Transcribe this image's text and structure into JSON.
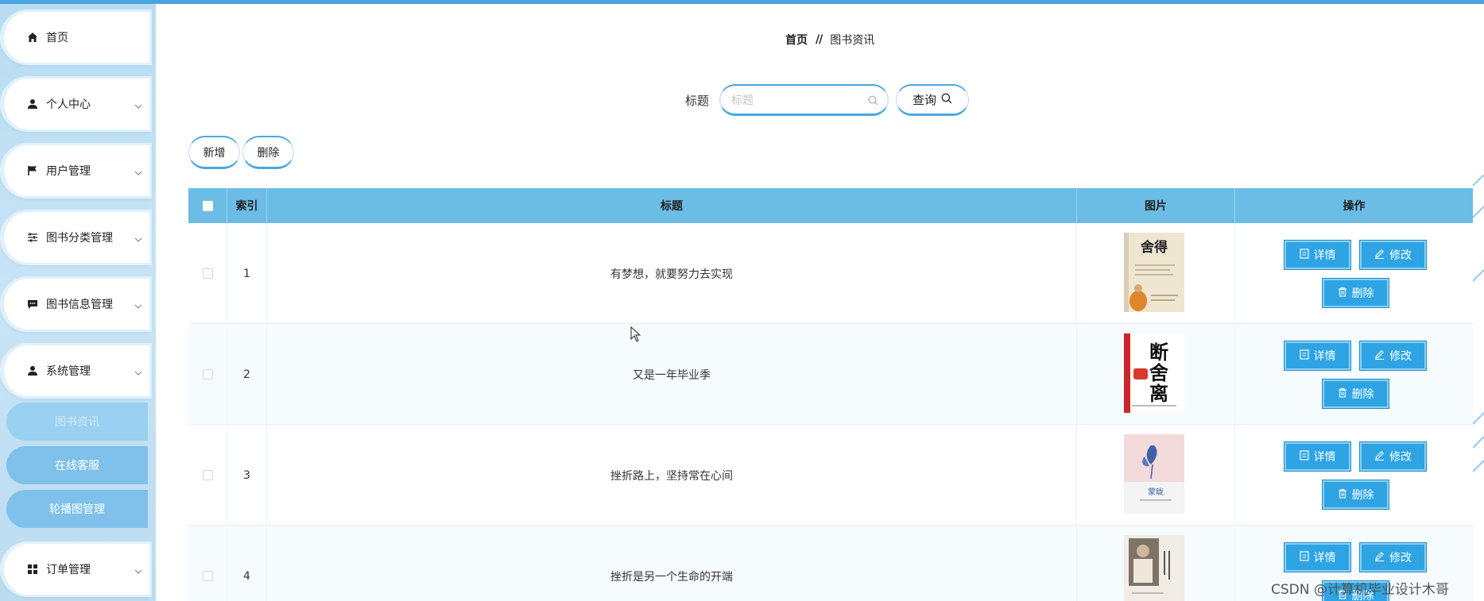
{
  "sidebar": {
    "items": [
      {
        "label": "首页"
      },
      {
        "label": "个人中心"
      },
      {
        "label": "用户管理"
      },
      {
        "label": "图书分类管理"
      },
      {
        "label": "图书信息管理"
      },
      {
        "label": "系统管理"
      },
      {
        "label": "订单管理"
      }
    ],
    "sub_items": [
      {
        "label": "图书资讯"
      },
      {
        "label": "在线客服"
      },
      {
        "label": "轮播图管理"
      }
    ]
  },
  "breadcrumb": {
    "home": "首页",
    "separator": "//",
    "current": "图书资讯"
  },
  "search": {
    "label": "标题",
    "placeholder": "标题",
    "button": "查询"
  },
  "actions": {
    "add": "新增",
    "delete": "删除"
  },
  "table": {
    "headers": {
      "index": "索引",
      "title": "标题",
      "image": "图片",
      "ops": "操作"
    },
    "rows": [
      {
        "index": "1",
        "title": "有梦想，就要努力去实现",
        "cover_text": "舍得"
      },
      {
        "index": "2",
        "title": "又是一年毕业季",
        "cover_text": "断舍离"
      },
      {
        "index": "3",
        "title": "挫折路上，坚持常在心间",
        "cover_text": "蒙眬"
      },
      {
        "index": "4",
        "title": "挫折是另一个生命的开端",
        "cover_text": ""
      }
    ],
    "op_labels": {
      "detail": "详情",
      "edit": "修改",
      "delete": "删除"
    }
  },
  "watermark": "CSDN @计算机毕业设计木哥",
  "colors": {
    "accent": "#2ea4e4",
    "header": "#6cbde6",
    "sidebar": "#c1e0f4"
  }
}
